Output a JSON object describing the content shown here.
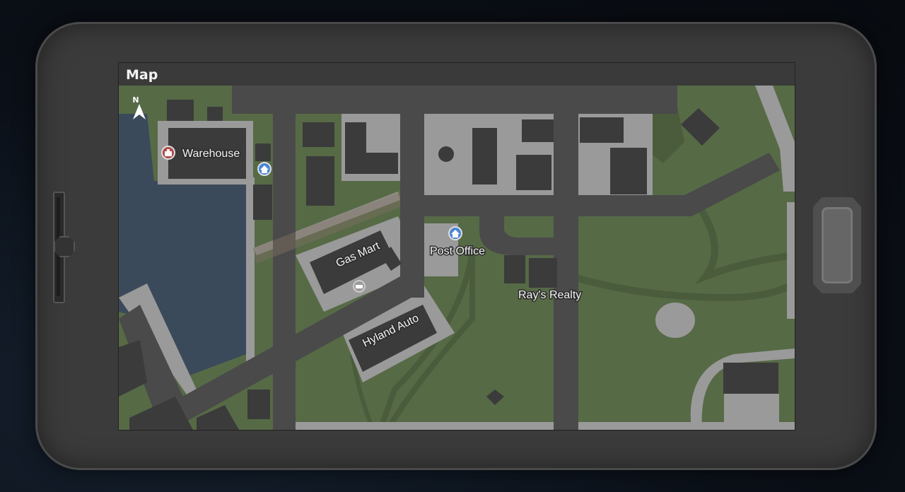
{
  "window": {
    "title": "Map"
  },
  "map": {
    "compass": {
      "label": "N"
    },
    "places": [
      {
        "name": "Warehouse",
        "icon": "briefcase-icon"
      },
      {
        "name": "Gas Mart",
        "icon": "car-icon"
      },
      {
        "name": "Post Office",
        "icon": "home-icon"
      },
      {
        "name": "Ray's Realty",
        "icon": "none"
      },
      {
        "name": "Hyland Auto",
        "icon": "none"
      }
    ]
  },
  "colors": {
    "grass": "#566a46",
    "road": "#4a4a4a",
    "sidewalk": "#9a9a9a",
    "building": "#3b3b3b",
    "water": "#3b4a5a",
    "home_marker": "#4a86d8",
    "warehouse_marker": "#b04848"
  }
}
